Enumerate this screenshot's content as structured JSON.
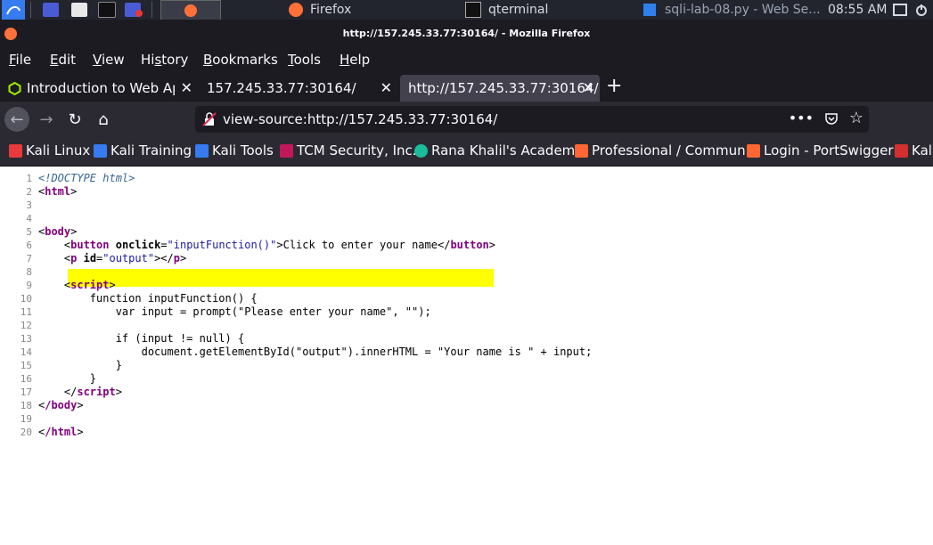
{
  "taskbar": {
    "firefox_label": "Firefox",
    "firefox_count": "2",
    "terminal_label": "qterminal",
    "terminal_count": "2",
    "vscode_label": "sqli-lab-08.py - Web Se...",
    "clock": "08:55 AM"
  },
  "window": {
    "title": "http://157.245.33.77:30164/ - Mozilla Firefox"
  },
  "menu": [
    {
      "label": "File",
      "u": "F",
      "rest": "ile"
    },
    {
      "label": "Edit",
      "u": "E",
      "rest": "dit"
    },
    {
      "label": "View",
      "u": "V",
      "rest": "iew"
    },
    {
      "label": "History",
      "pre": "Hi",
      "u": "s",
      "rest": "tory"
    },
    {
      "label": "Bookmarks",
      "u": "B",
      "rest": "ookmarks"
    },
    {
      "label": "Tools",
      "u": "T",
      "rest": "ools"
    },
    {
      "label": "Help",
      "u": "H",
      "rest": "elp"
    }
  ],
  "tabs": [
    {
      "label": "Introduction to Web Applic"
    },
    {
      "label": "157.245.33.77:30164/"
    },
    {
      "label": "http://157.245.33.77:30164/"
    }
  ],
  "urlbar": {
    "url": "view-source:http://157.245.33.77:30164/"
  },
  "bookmarks": [
    {
      "label": "Kali Linux",
      "color": "#e83a3a"
    },
    {
      "label": "Kali Training",
      "color": "#367bf0"
    },
    {
      "label": "Kali Tools",
      "color": "#367bf0"
    },
    {
      "label": "TCM Security, Inc.",
      "color": "#c2185b"
    },
    {
      "label": "Rana Khalil's Academy",
      "color": "#1abc9c"
    },
    {
      "label": "Professional / Commun...",
      "color": "#ff6633"
    },
    {
      "label": "Login - PortSwigger",
      "color": "#ff6633"
    },
    {
      "label": "Kali",
      "color": "#d32f2f"
    }
  ],
  "source": {
    "line_numbers": [
      "1",
      "2",
      "3",
      "4",
      "5",
      "6",
      "7",
      "8",
      "9",
      "10",
      "11",
      "12",
      "13",
      "14",
      "15",
      "16",
      "17",
      "18",
      "19",
      "20"
    ],
    "doctype": "<!DOCTYPE html>",
    "html_open": "html",
    "body_open": "body",
    "button_tag": "button",
    "onclick_attr": "onclick",
    "onclick_val": "\"inputFunction()\"",
    "button_text": "Click to enter your name",
    "p_tag": "p",
    "id_attr": "id",
    "id_val": "\"output\"",
    "script_tag": "script",
    "l10": "function inputFunction() {",
    "l11": "var input = prompt(\"Please enter your name\", \"\");",
    "l13": "if (input != null) {",
    "l14": "document.getElementById(\"output\").innerHTML = \"Your name is \" + input;",
    "l15": "}",
    "l16": "}",
    "body_close": "/body",
    "html_close": "/html"
  }
}
